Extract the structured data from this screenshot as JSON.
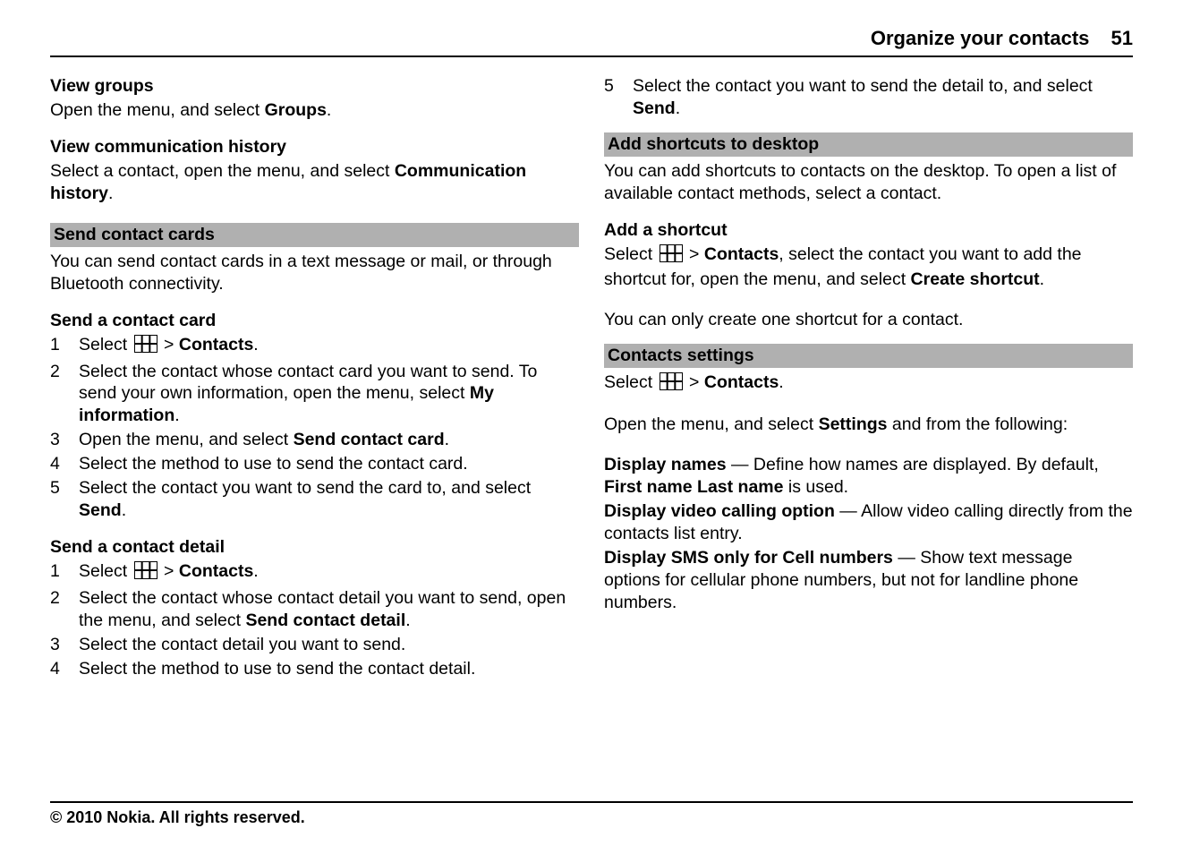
{
  "header": {
    "title": "Organize your contacts",
    "page": "51"
  },
  "footer": {
    "copyright": "© 2010 Nokia. All rights reserved."
  },
  "left": {
    "view_groups": {
      "h": "View groups",
      "p1a": "Open the menu, and select ",
      "groups": "Groups",
      "p1b": "."
    },
    "view_comm": {
      "h": "View communication history",
      "p1a": "Select a contact, open the menu, and select ",
      "comm_hist": "Communication history",
      "p1b": "."
    },
    "send_cards": {
      "bar": "Send contact cards",
      "intro": "You can send contact cards in a text message or mail, or through Bluetooth connectivity.",
      "h_card": "Send a contact card",
      "s1a": "Select ",
      "s1_gt": " > ",
      "s1_contacts": "Contacts",
      "s1b": ".",
      "s2a": "Select the contact whose contact card you want to send. To send your own information, open the menu, select ",
      "s2_my": "My information",
      "s2b": ".",
      "s3a": "Open the menu, and select ",
      "s3_scc": "Send contact card",
      "s3b": ".",
      "s4": "Select the method to use to send the contact card.",
      "s5a": "Select the contact you want to send the card to, and select ",
      "s5_send": "Send",
      "s5b": ".",
      "h_detail": "Send a contact detail",
      "d1a": "Select ",
      "d1_gt": " > ",
      "d1_contacts": "Contacts",
      "d1b": ".",
      "d2a": "Select the contact whose contact detail you want to send, open the menu, and select ",
      "d2_scd": "Send contact detail",
      "d2b": ".",
      "d3": "Select the contact detail you want to send.",
      "d4": "Select the method to use to send the contact detail."
    }
  },
  "right": {
    "d5a": "Select the contact you want to send the detail to, and select ",
    "d5_send": "Send",
    "d5b": ".",
    "shortcuts": {
      "bar": "Add shortcuts to desktop",
      "intro": "You can add shortcuts to contacts on the desktop. To open a list of available contact methods, select a contact.",
      "h": "Add a shortcut",
      "p1a": "Select ",
      "p1_gt": " > ",
      "p1_contacts": "Contacts",
      "p1b": ", select the contact you want to add the shortcut for, open the menu, and select ",
      "p1_cs": "Create shortcut",
      "p1c": ".",
      "note": "You can only create one shortcut for a contact."
    },
    "settings": {
      "bar": "Contacts settings",
      "p1a": "Select ",
      "p1_gt": " > ",
      "p1_contacts": "Contacts",
      "p1b": ".",
      "p2a": "Open the menu, and select ",
      "p2_settings": "Settings",
      "p2b": " and from the following:",
      "dn_t": "Display names",
      "dn_sep": "  —  ",
      "dn_a": "Define how names are displayed. By default, ",
      "dn_fl": "First name Last name",
      "dn_b": " is used.",
      "dv_t": "Display video calling option",
      "dv_sep": "  —  ",
      "dv": "Allow video calling directly from the contacts list entry.",
      "ds_t": "Display SMS only for Cell numbers",
      "ds_sep": "  —  ",
      "ds": "Show text message options for cellular phone numbers, but not for landline phone numbers."
    }
  },
  "nums": {
    "n1": "1",
    "n2": "2",
    "n3": "3",
    "n4": "4",
    "n5": "5"
  }
}
